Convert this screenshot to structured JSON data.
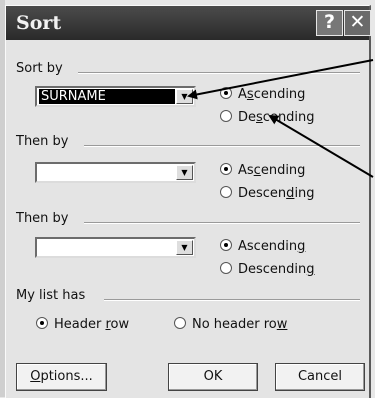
{
  "window": {
    "title": "Sort",
    "help_glyph": "?",
    "close_glyph": "✕"
  },
  "sort_by": {
    "label": "Sort by",
    "combo_value": "SURNAME",
    "asc_pre": "A",
    "asc_key": "s",
    "asc_post": "cending",
    "desc_pre": "De",
    "desc_key": "s",
    "desc_post": "cending",
    "selected": "ascending"
  },
  "then_by_1": {
    "label": "Then by",
    "combo_value": "",
    "asc_pre": "As",
    "asc_key": "c",
    "asc_post": "ending",
    "desc_pre": "Descen",
    "desc_key": "d",
    "desc_post": "ing",
    "selected": "ascending"
  },
  "then_by_2": {
    "label": "Then by",
    "combo_value": "",
    "asc_pre": "Ascendin",
    "asc_key": "g",
    "asc_post": "",
    "desc_pre": "Descendin",
    "desc_key": "g",
    "desc_post": "",
    "selected": "ascending"
  },
  "my_list_has": {
    "label": "My list has",
    "header_pre": "Header ",
    "header_key": "r",
    "header_post": "ow",
    "no_header_pre": "No header ro",
    "no_header_key": "w",
    "no_header_post": "",
    "selected": "header"
  },
  "buttons": {
    "options_pre": "",
    "options_key": "O",
    "options_post": "ptions...",
    "ok": "OK",
    "cancel": "Cancel"
  },
  "icons": [
    "help-icon",
    "close-icon",
    "dropdown-arrow-icon",
    "annotation-arrow-icon"
  ]
}
